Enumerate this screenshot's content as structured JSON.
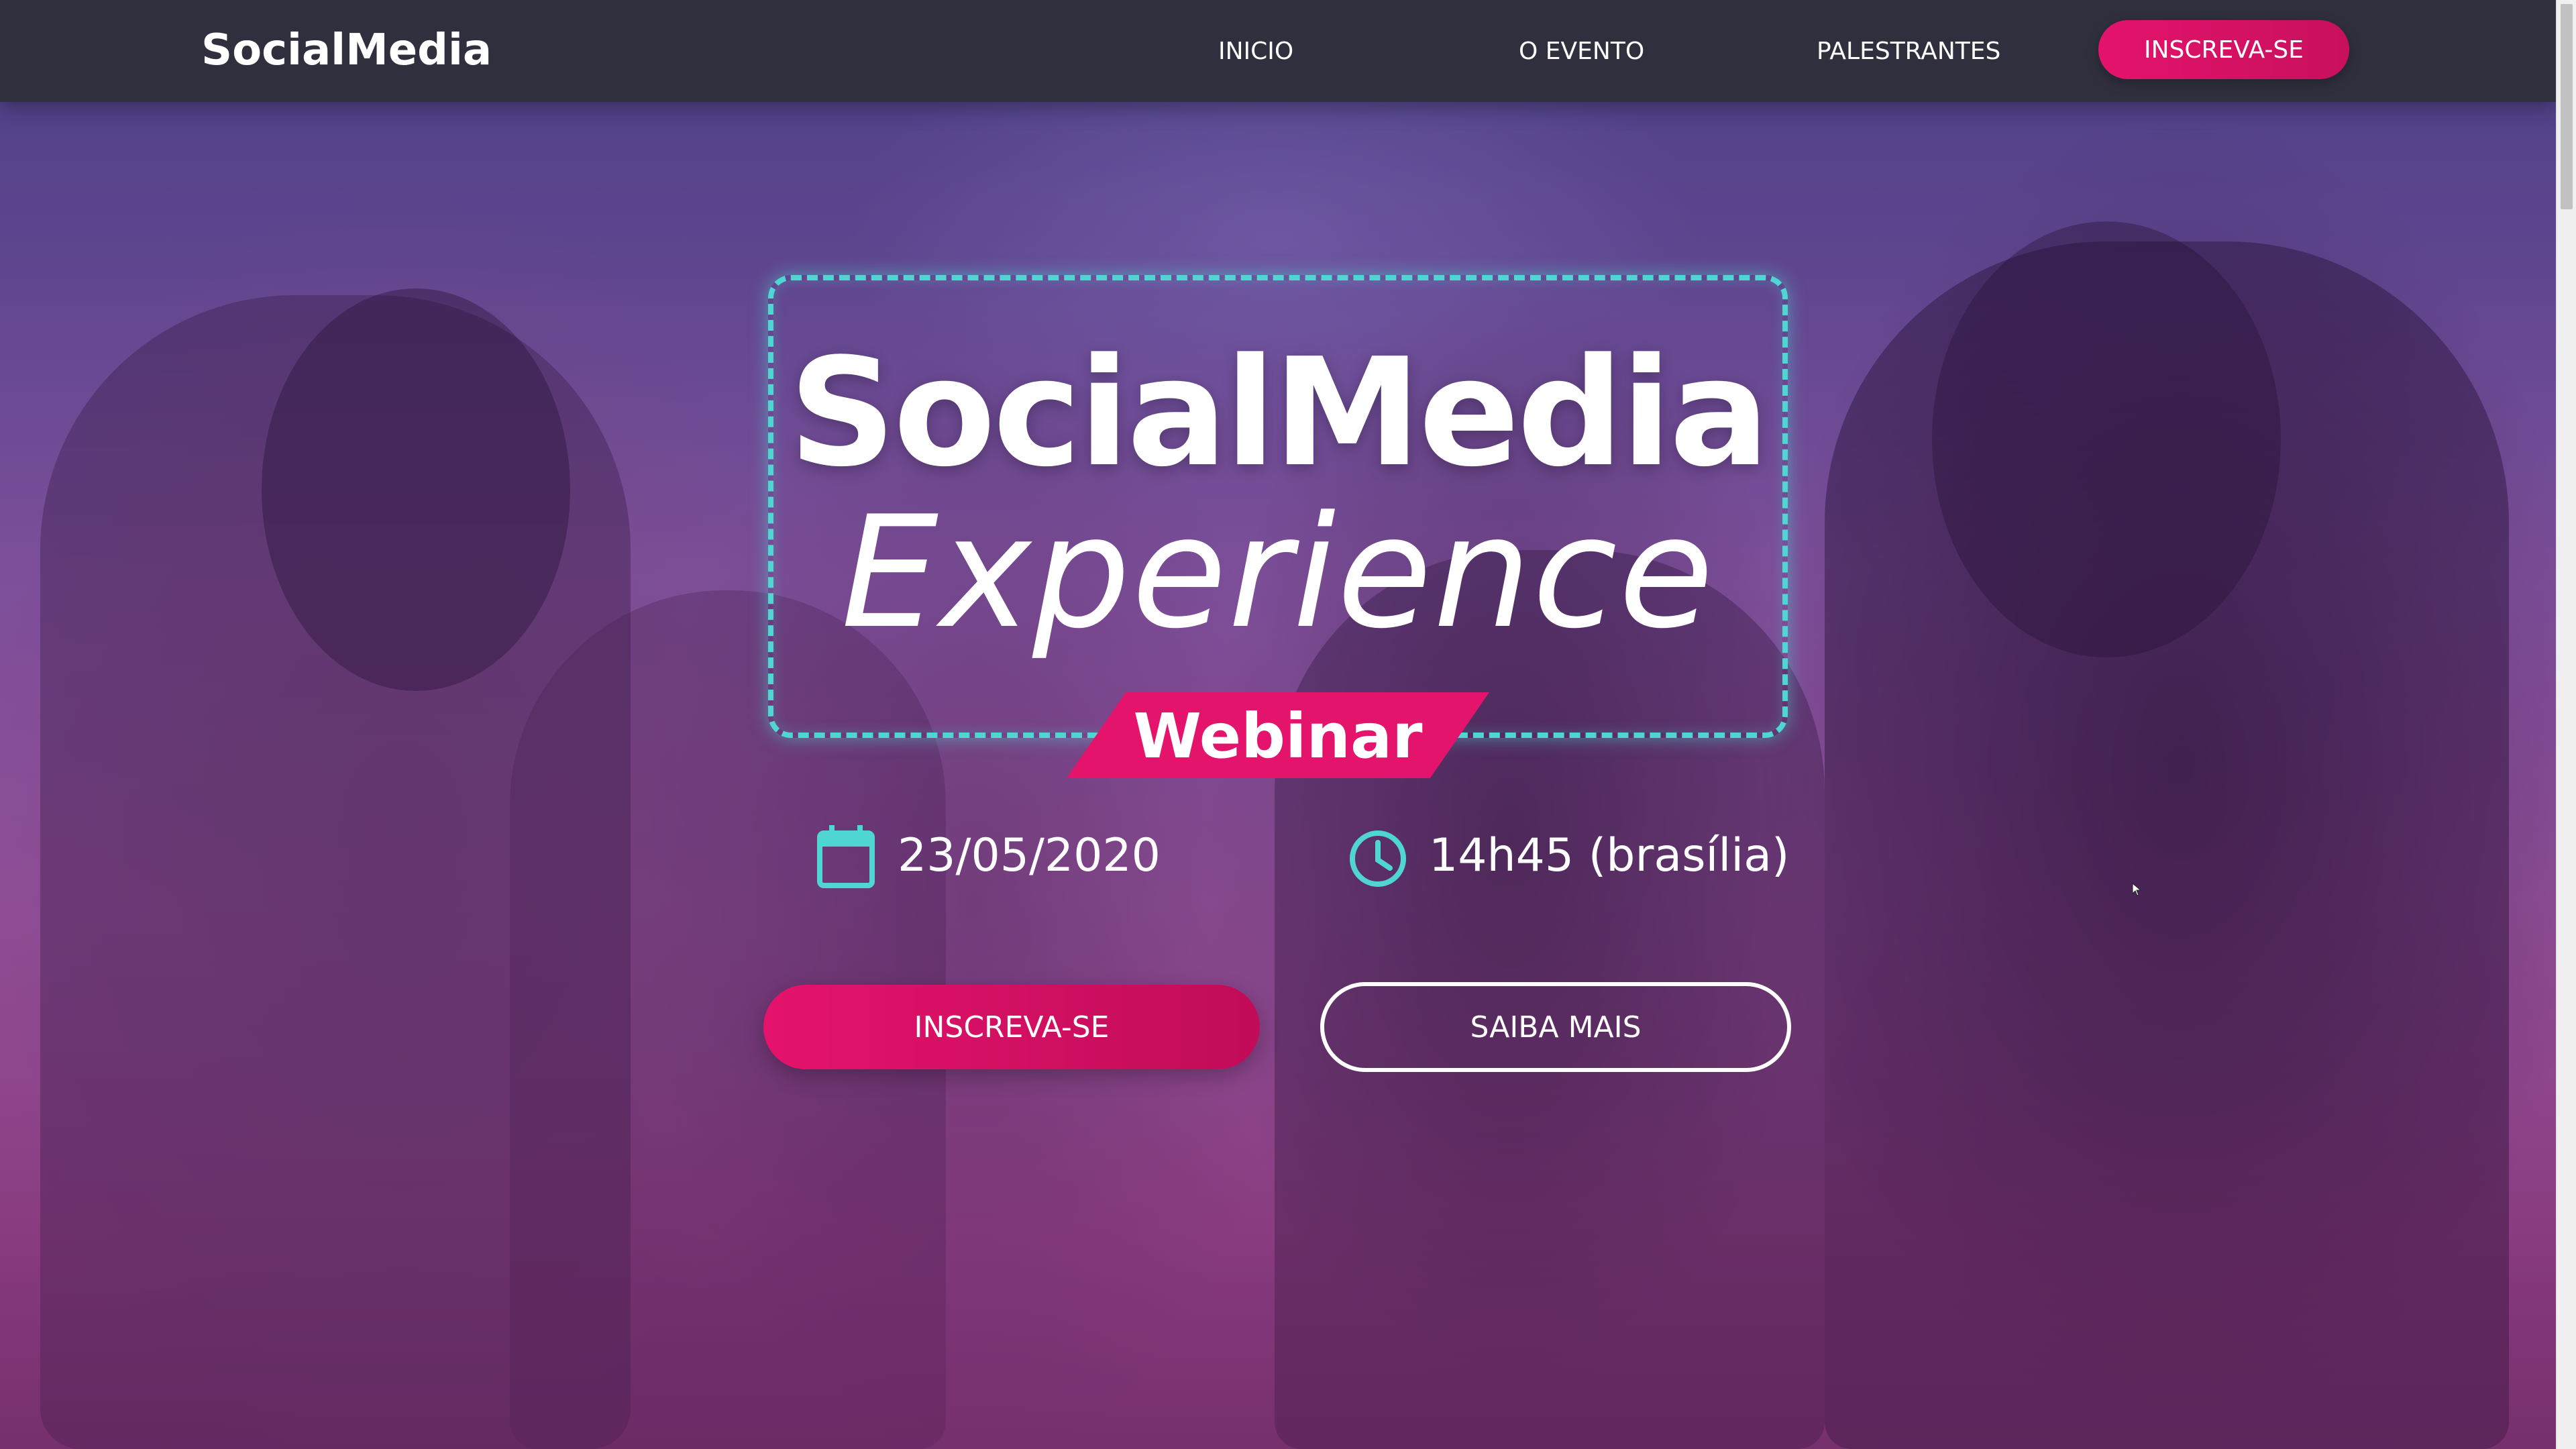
{
  "navbar": {
    "brand": "SocialMedia",
    "links": [
      "INICIO",
      "O EVENTO",
      "PALESTRANTES"
    ],
    "cta": "INSCREVA-SE"
  },
  "hero": {
    "title_main": "SocialMedia",
    "title_sub": "Experience",
    "badge": "Webinar",
    "date": "23/05/2020",
    "time": "14h45 (brasília)",
    "primary_button": "INSCREVA-SE",
    "secondary_button": "SAIBA MAIS"
  },
  "icons": {
    "calendar": "calendar-icon",
    "clock": "clock-icon"
  },
  "colors": {
    "accent": "#e4136c",
    "neon": "#4fd6d2",
    "navbar": "#2f2f3e"
  }
}
